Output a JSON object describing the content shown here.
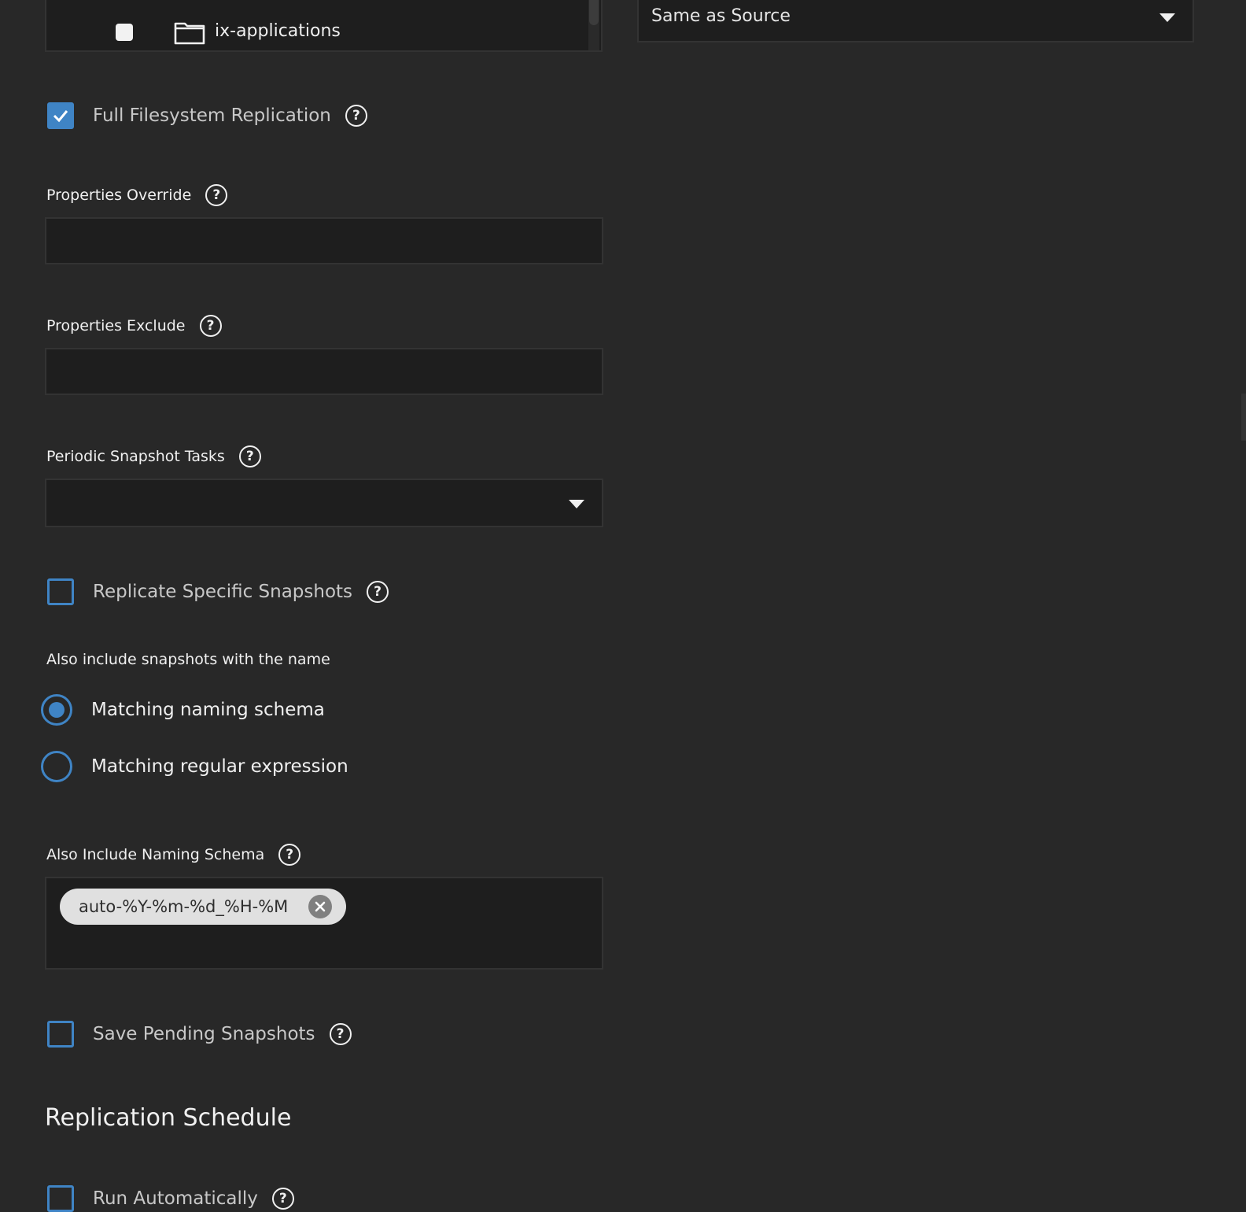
{
  "tree": {
    "items": [
      {
        "label": "ix-applications",
        "checked": false
      }
    ]
  },
  "destination": {
    "selected": "Same as Source"
  },
  "full_filesystem": {
    "label": "Full Filesystem Replication",
    "checked": true
  },
  "properties_override": {
    "label": "Properties Override",
    "value": ""
  },
  "properties_exclude": {
    "label": "Properties Exclude",
    "value": ""
  },
  "periodic_tasks": {
    "label": "Periodic Snapshot Tasks",
    "selected": ""
  },
  "replicate_specific": {
    "label": "Replicate Specific Snapshots",
    "checked": false
  },
  "also_include": {
    "label": "Also include snapshots with the name",
    "options": [
      {
        "label": "Matching naming schema",
        "selected": true
      },
      {
        "label": "Matching regular expression",
        "selected": false
      }
    ]
  },
  "naming_schema": {
    "label": "Also Include Naming Schema",
    "chips": [
      "auto-%Y-%m-%d_%H-%M"
    ]
  },
  "save_pending": {
    "label": "Save Pending Snapshots",
    "checked": false
  },
  "schedule": {
    "title": "Replication Schedule",
    "run_automatically": {
      "label": "Run Automatically",
      "checked": false
    }
  },
  "help_glyph": "?",
  "colors": {
    "background": "#282828",
    "input_background": "#1e1e1e",
    "accent": "#3f84c5",
    "chip": "#e0e0e0"
  },
  "icons": {
    "help": "help-circle-icon",
    "folder": "folder-icon",
    "caret": "caret-down-icon",
    "chip_remove": "close-circle-icon",
    "check": "checkmark-icon"
  }
}
